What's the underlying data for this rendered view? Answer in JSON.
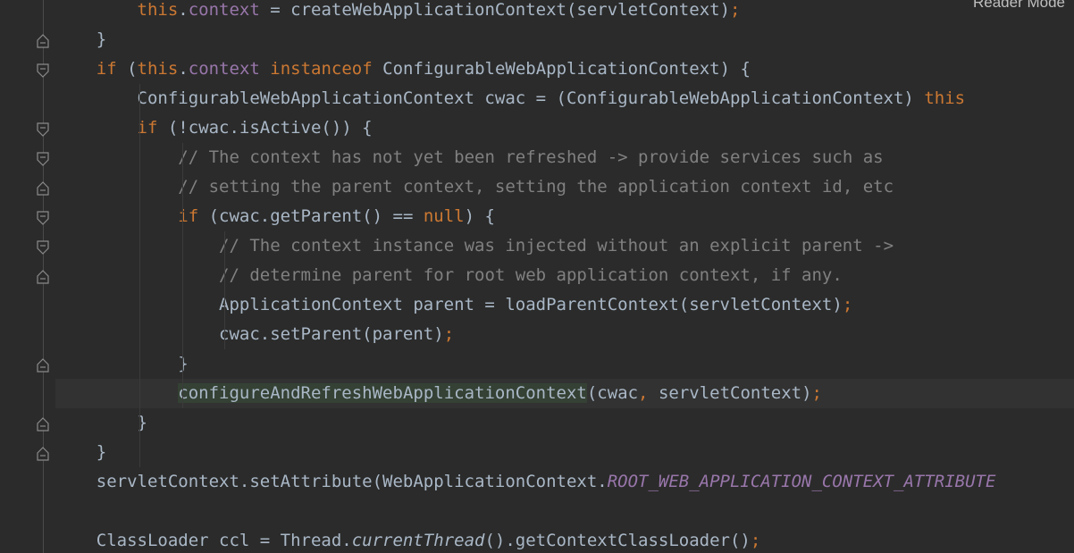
{
  "editor": {
    "reader_mode_label": "Reader Mode",
    "lines": [
      [
        {
          "t": "        "
        },
        {
          "t": "this",
          "c": "kw"
        },
        {
          "t": "."
        },
        {
          "t": "context",
          "c": "fld"
        },
        {
          "t": " = createWebApplicationContext(servletContext)"
        },
        {
          "t": ";",
          "c": "kw"
        }
      ],
      [
        {
          "t": "    }"
        }
      ],
      [
        {
          "t": "    "
        },
        {
          "t": "if",
          "c": "kw"
        },
        {
          "t": " ("
        },
        {
          "t": "this",
          "c": "kw"
        },
        {
          "t": "."
        },
        {
          "t": "context",
          "c": "fld"
        },
        {
          "t": " "
        },
        {
          "t": "instanceof",
          "c": "kw"
        },
        {
          "t": " ConfigurableWebApplicationContext) {"
        }
      ],
      [
        {
          "t": "        ConfigurableWebApplicationContext cwac = (ConfigurableWebApplicationContext) "
        },
        {
          "t": "this",
          "c": "kw"
        }
      ],
      [
        {
          "t": "        "
        },
        {
          "t": "if",
          "c": "kw"
        },
        {
          "t": " (!cwac.isActive()) {"
        }
      ],
      [
        {
          "t": "            "
        },
        {
          "t": "// The context has not yet been refreshed -> provide services such as",
          "c": "cm"
        }
      ],
      [
        {
          "t": "            "
        },
        {
          "t": "// setting the parent context, setting the application context id, etc",
          "c": "cm"
        }
      ],
      [
        {
          "t": "            "
        },
        {
          "t": "if",
          "c": "kw"
        },
        {
          "t": " (cwac.getParent() == "
        },
        {
          "t": "null",
          "c": "kw"
        },
        {
          "t": ") {"
        }
      ],
      [
        {
          "t": "                "
        },
        {
          "t": "// The context instance was injected without an explicit parent ->",
          "c": "cm"
        }
      ],
      [
        {
          "t": "                "
        },
        {
          "t": "// determine parent for root web application context, if any.",
          "c": "cm"
        }
      ],
      [
        {
          "t": "                ApplicationContext parent = loadParentContext(servletContext)"
        },
        {
          "t": ";",
          "c": "kw"
        }
      ],
      [
        {
          "t": "                cwac.setParent(parent)"
        },
        {
          "t": ";",
          "c": "kw"
        }
      ],
      [
        {
          "t": "            }"
        }
      ],
      [
        {
          "t": "            "
        },
        {
          "t": "configureAndRefreshWebApplicationContext",
          "c": "fn-hl"
        },
        {
          "t": "(cwac"
        },
        {
          "t": ",",
          "c": "kw"
        },
        {
          "t": " servletContext)"
        },
        {
          "t": ";",
          "c": "kw"
        }
      ],
      [
        {
          "t": "        }"
        }
      ],
      [
        {
          "t": "    }"
        }
      ],
      [
        {
          "t": "    servletContext.setAttribute(WebApplicationContext."
        },
        {
          "t": "ROOT_WEB_APPLICATION_CONTEXT_ATTRIBUTE",
          "c": "const"
        }
      ],
      [
        {
          "t": ""
        }
      ],
      [
        {
          "t": "    ClassLoader ccl = Thread."
        },
        {
          "t": "currentThread",
          "c": "it"
        },
        {
          "t": "().getContextClassLoader()"
        },
        {
          "t": ";",
          "c": "kw"
        }
      ]
    ],
    "current_line": 13,
    "fold_markers": [
      {
        "line": 1,
        "type": "end"
      },
      {
        "line": 2,
        "type": "start"
      },
      {
        "line": 4,
        "type": "start"
      },
      {
        "line": 5,
        "type": "start"
      },
      {
        "line": 6,
        "type": "end"
      },
      {
        "line": 7,
        "type": "start"
      },
      {
        "line": 8,
        "type": "start"
      },
      {
        "line": 9,
        "type": "end"
      },
      {
        "line": 12,
        "type": "end"
      },
      {
        "line": 14,
        "type": "end"
      },
      {
        "line": 15,
        "type": "end"
      }
    ]
  }
}
